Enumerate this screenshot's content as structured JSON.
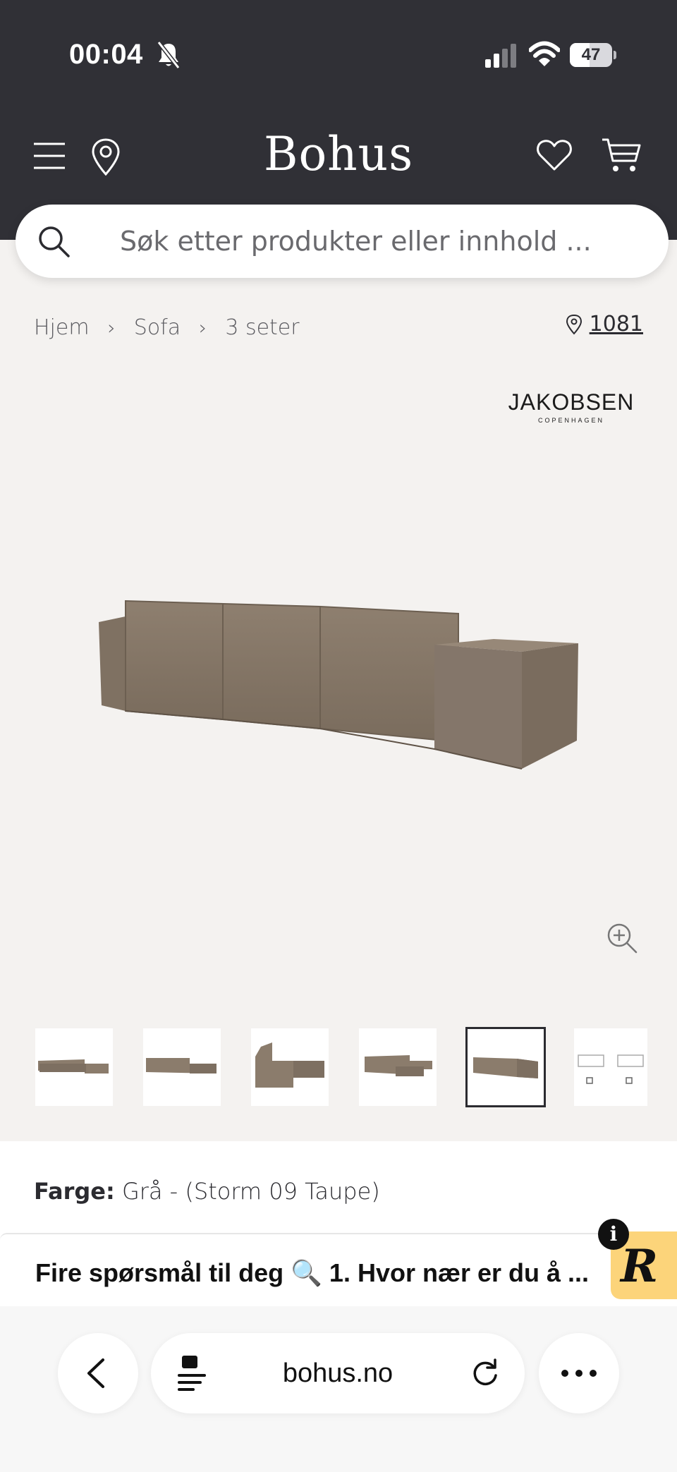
{
  "status_bar": {
    "time": "00:04",
    "battery": "47",
    "battery_level": 0.47
  },
  "header": {
    "logo": "Bohus"
  },
  "search": {
    "placeholder": "Søk etter produkter eller innhold ..."
  },
  "breadcrumb": {
    "items": [
      "Hjem",
      "Sofa",
      "3 seter"
    ]
  },
  "store": {
    "label": "1081"
  },
  "brand": {
    "name": "JAKOBSEN",
    "sub": "COPENHAGEN"
  },
  "product": {
    "color_label": "Farge:",
    "color_value": "Grå - (Storm 09 Taupe)"
  },
  "banner": {
    "text": "Fire spørsmål til deg 🔍 1. Hvor nær er du å ...",
    "badge_letter": "R",
    "info_letter": "i"
  },
  "browser": {
    "url": "bohus.no"
  },
  "colors": {
    "header_bg": "#303036",
    "page_bg": "#f4f2f0",
    "sofa": "#8b7c6c",
    "badge": "#fcd47a"
  },
  "thumbnails": {
    "count": 6,
    "selected_index": 4
  }
}
